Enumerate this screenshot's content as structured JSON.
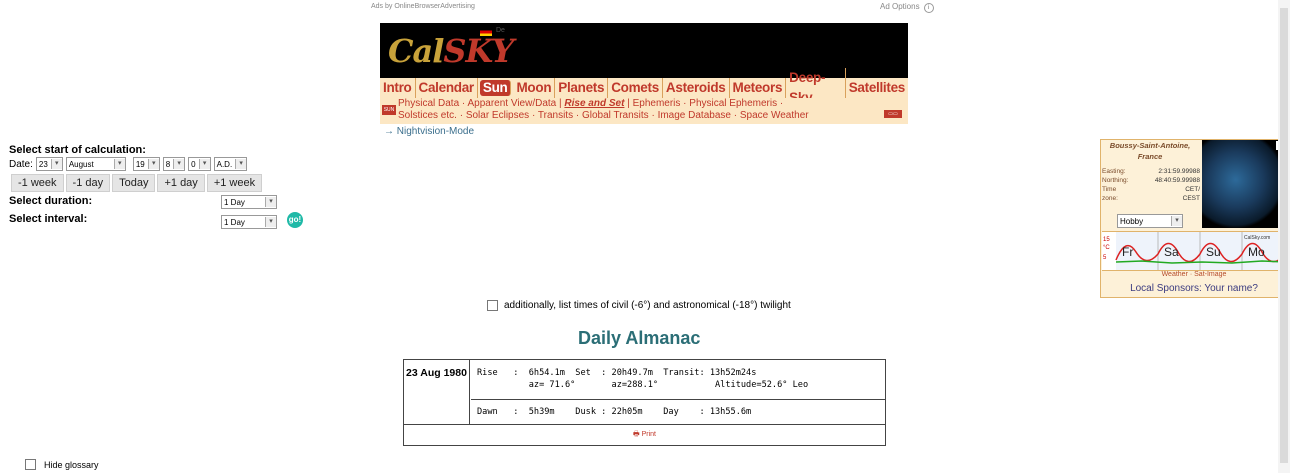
{
  "ads": {
    "left_text": "Ads by OnlineBrowserAdvertising",
    "right_text": "Ad Options",
    "info_icon": "info-icon"
  },
  "header": {
    "logo_text_a": "Cal",
    "logo_text_b": "SKY",
    "flag_label": "De",
    "nav": [
      "Intro",
      "Calendar",
      "Sun",
      "Moon",
      "Planets",
      "Comets",
      "Asteroids",
      "Meteors",
      "Deep-Sky",
      "Satellites"
    ],
    "active_nav": "Sun",
    "subnav_line1": {
      "a": "Physical Data",
      "b": "Apparent View/Data",
      "c": "Rise and Set",
      "d": "Ephemeris",
      "e": "Physical Ephemeris"
    },
    "subnav_line2": {
      "a": "Solstices etc.",
      "b": "Solar Eclipses",
      "c": "Transits",
      "d": "Global Transits",
      "e": "Image Database",
      "f": "Space Weather"
    },
    "nightvision": "→ Nightvision-Mode"
  },
  "form": {
    "title": "Select start of calculation:",
    "date_label": "Date:",
    "day": "23",
    "month": "August",
    "year": "19",
    "hour": "8",
    "minute": "0",
    "era": "A.D.",
    "buttons": [
      "-1 week",
      "-1 day",
      "Today",
      "+1 day",
      "+1 week"
    ],
    "duration_label": "Select duration:",
    "duration_value": "1 Day",
    "interval_label": "Select interval:",
    "interval_value": "1 Day",
    "go_label": "go!"
  },
  "widget": {
    "city": "Boussy-Saint-Antoine, France",
    "rows": [
      {
        "k": "Easting:",
        "v": "2:31:59.99988"
      },
      {
        "k": "Northing:",
        "v": "48:40:59.99988"
      },
      {
        "k": "Time",
        "v": "CET/"
      },
      {
        "k": "zone:",
        "v": "CEST"
      }
    ],
    "mode": "Hobby",
    "days": [
      "Fr",
      "Sa",
      "Su",
      "Mo"
    ],
    "temps": [
      "15",
      "°C",
      "5"
    ],
    "links": "Weather · Sat-Image",
    "sponsor": "Local Sponsors: Your name?",
    "brand": "CalSky.com"
  },
  "main": {
    "twilight_label": "additionally, list times of civil (-6°) and astronomical (-18°) twilight",
    "title": "Daily Almanac",
    "date": "23 Aug 1980",
    "row1_line1": "Rise   :  6h54.1m  Set  : 20h49.7m  Transit: 13h52m24s",
    "row1_line2": "          az= 71.6°       az=288.1°           Altitude=52.6° Leo",
    "row2": "Dawn   :  5h39m    Dusk : 22h05m    Day    : 13h55.6m",
    "print": "Print"
  },
  "glossary_label": "Hide glossary",
  "colors": {
    "accent": "#c0392b",
    "teal": "#2b6e76",
    "nav_bg": "#fce7c4"
  }
}
